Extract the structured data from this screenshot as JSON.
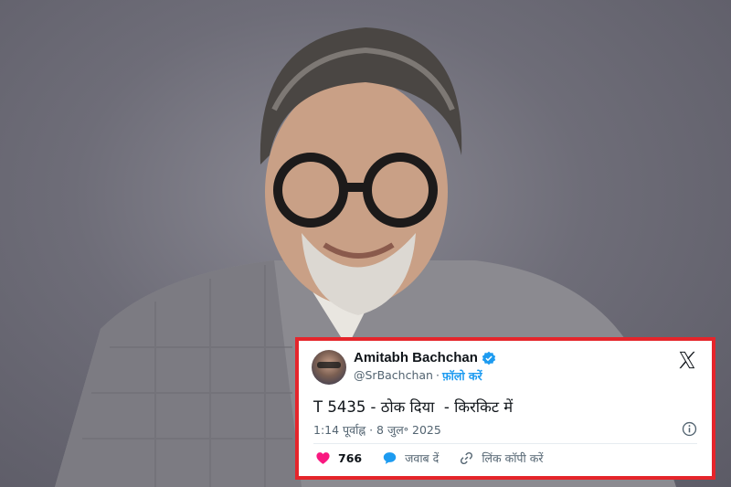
{
  "tweet": {
    "display_name": "Amitabh Bachchan",
    "handle": "@SrBachchan",
    "separator": "·",
    "follow_label": "फ़ॉलो करें",
    "text": "T 5435 - ठोक दिया  - किरकिट में",
    "timestamp": "1:14 पूर्वाह्न · 8 जुल॰ 2025",
    "like_count": "766",
    "reply_label": "जवाब दें",
    "copy_link_label": "लिंक कॉपी करें"
  },
  "colors": {
    "frame_border": "#e5252b",
    "link_blue": "#1d9bf0",
    "like_pink": "#f91880",
    "text_dark": "#0f1419",
    "text_gray": "#536471"
  },
  "icons": [
    "verified-badge-icon",
    "x-logo-icon",
    "info-icon",
    "heart-icon",
    "reply-bubble-icon",
    "link-icon"
  ]
}
